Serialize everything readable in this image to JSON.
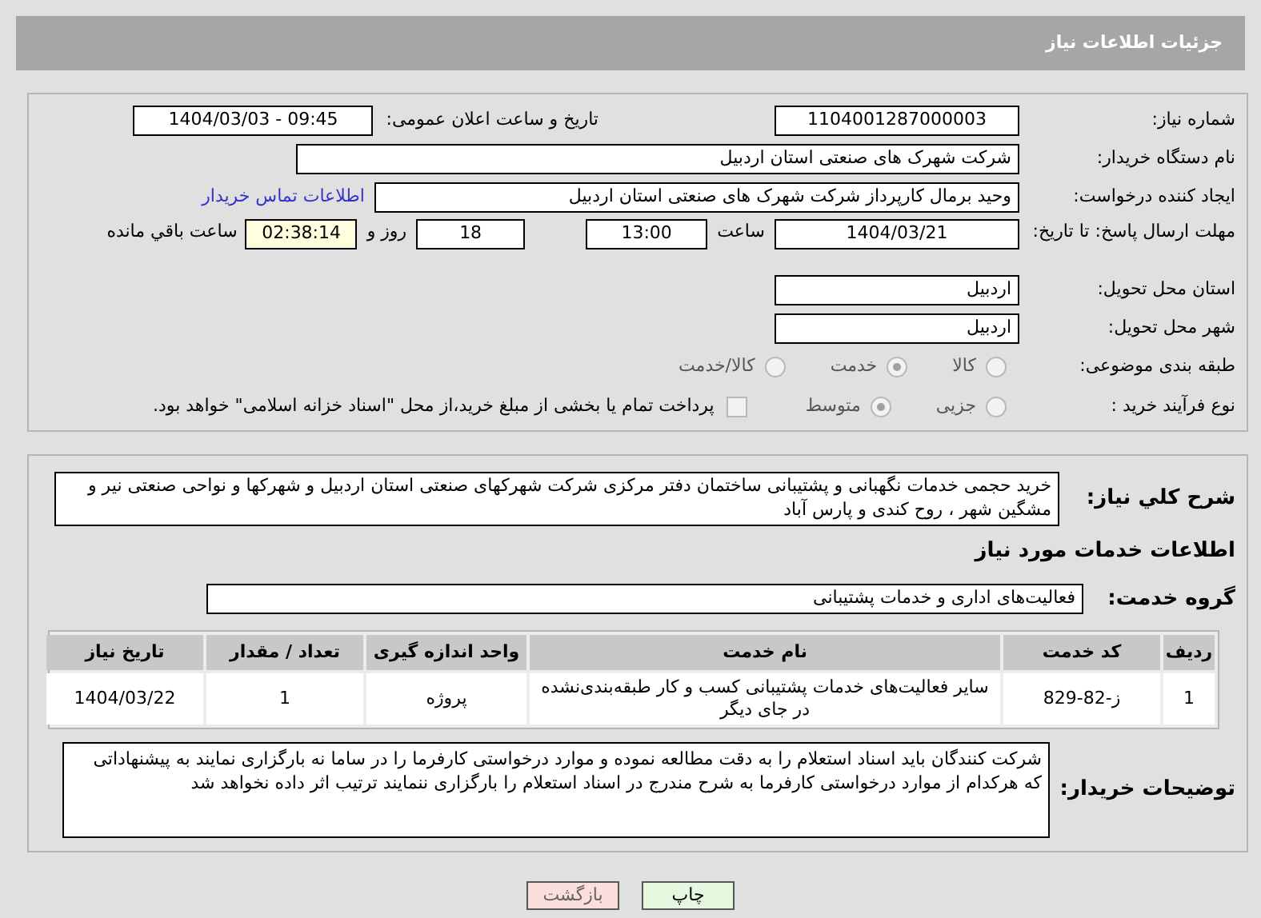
{
  "header": {
    "title": "جزئیات اطلاعات نیاز"
  },
  "need_info": {
    "need_number": {
      "label": "شماره نیاز:",
      "value": "1104001287000003"
    },
    "announce_datetime": {
      "label": "تاریخ و ساعت اعلان عمومی:",
      "value": "1404/03/03 - 09:45"
    },
    "buyer_org": {
      "label": "نام دستگاه خریدار:",
      "value": "شرکت شهرک های صنعتی استان اردبیل"
    },
    "requester": {
      "label": "ایجاد کننده درخواست:",
      "value": "وحید برمال کارپرداز شرکت شهرک های صنعتی استان اردبیل",
      "link": "اطلاعات تماس خریدار"
    },
    "deadline": {
      "label": "مهلت ارسال پاسخ: تا تاریخ:",
      "date": "1404/03/21",
      "time_label": "ساعت",
      "time": "13:00",
      "days": "18",
      "days_label": "روز و",
      "remaining": "02:38:14",
      "remaining_label": "ساعت باقي مانده"
    },
    "province": {
      "label": "استان محل تحویل:",
      "value": "اردبیل"
    },
    "city": {
      "label": "شهر محل تحویل:",
      "value": "اردبیل"
    },
    "category": {
      "label": "طبقه بندی موضوعی:",
      "options": [
        {
          "label": "کالا",
          "selected": false
        },
        {
          "label": "خدمت",
          "selected": true
        },
        {
          "label": "کالا/خدمت",
          "selected": false
        }
      ]
    },
    "process": {
      "label": "نوع فرآیند خرید :",
      "options": [
        {
          "label": "جزیی",
          "selected": false
        },
        {
          "label": "متوسط",
          "selected": true
        }
      ],
      "treasury": {
        "checked": false,
        "text": "پرداخت تمام یا بخشی از مبلغ خرید،از محل \"اسناد خزانه اسلامی\" خواهد بود."
      }
    }
  },
  "details": {
    "description": {
      "label": "شرح کلي نیاز:",
      "value": "خرید حجمی خدمات نگهبانی و پشتیبانی ساختمان دفتر مرکزی شرکت شهرکهای صنعتی استان اردبیل و شهرکها و نواحی صنعتی نیر و مشگین شهر ، روح کندی و پارس آباد"
    },
    "services_title": "اطلاعات خدمات مورد نیاز",
    "service_group": {
      "label": "گروه خدمت:",
      "value": "فعالیت‌های اداری و خدمات پشتیبانی"
    },
    "table": {
      "columns": [
        "ردیف",
        "کد خدمت",
        "نام خدمت",
        "واحد اندازه گیری",
        "تعداد / مقدار",
        "تاریخ نیاز"
      ],
      "rows": [
        [
          "1",
          "ز-82-829",
          "سایر فعالیت‌های خدمات پشتیبانی کسب و کار طبقه‌بندی‌نشده در جای دیگر",
          "پروژه",
          "1",
          "1404/03/22"
        ]
      ]
    },
    "buyer_notes": {
      "label": "توضیحات خریدار:",
      "value": "شرکت کنندگان باید اسناد استعلام را به دقت مطالعه نموده و موارد درخواستی کارفرما را در ساما نه بارگزاری نمایند به پیشنهاداتی که هرکدام از موارد درخواستی کارفرما به شرح مندرج در اسناد استعلام  را بارگزاری ننمایند ترتیب اثر داده نخواهد شد"
    }
  },
  "buttons": [
    {
      "label": "چاپ",
      "kind": "print"
    },
    {
      "label": "بازگشت",
      "kind": "back"
    }
  ]
}
